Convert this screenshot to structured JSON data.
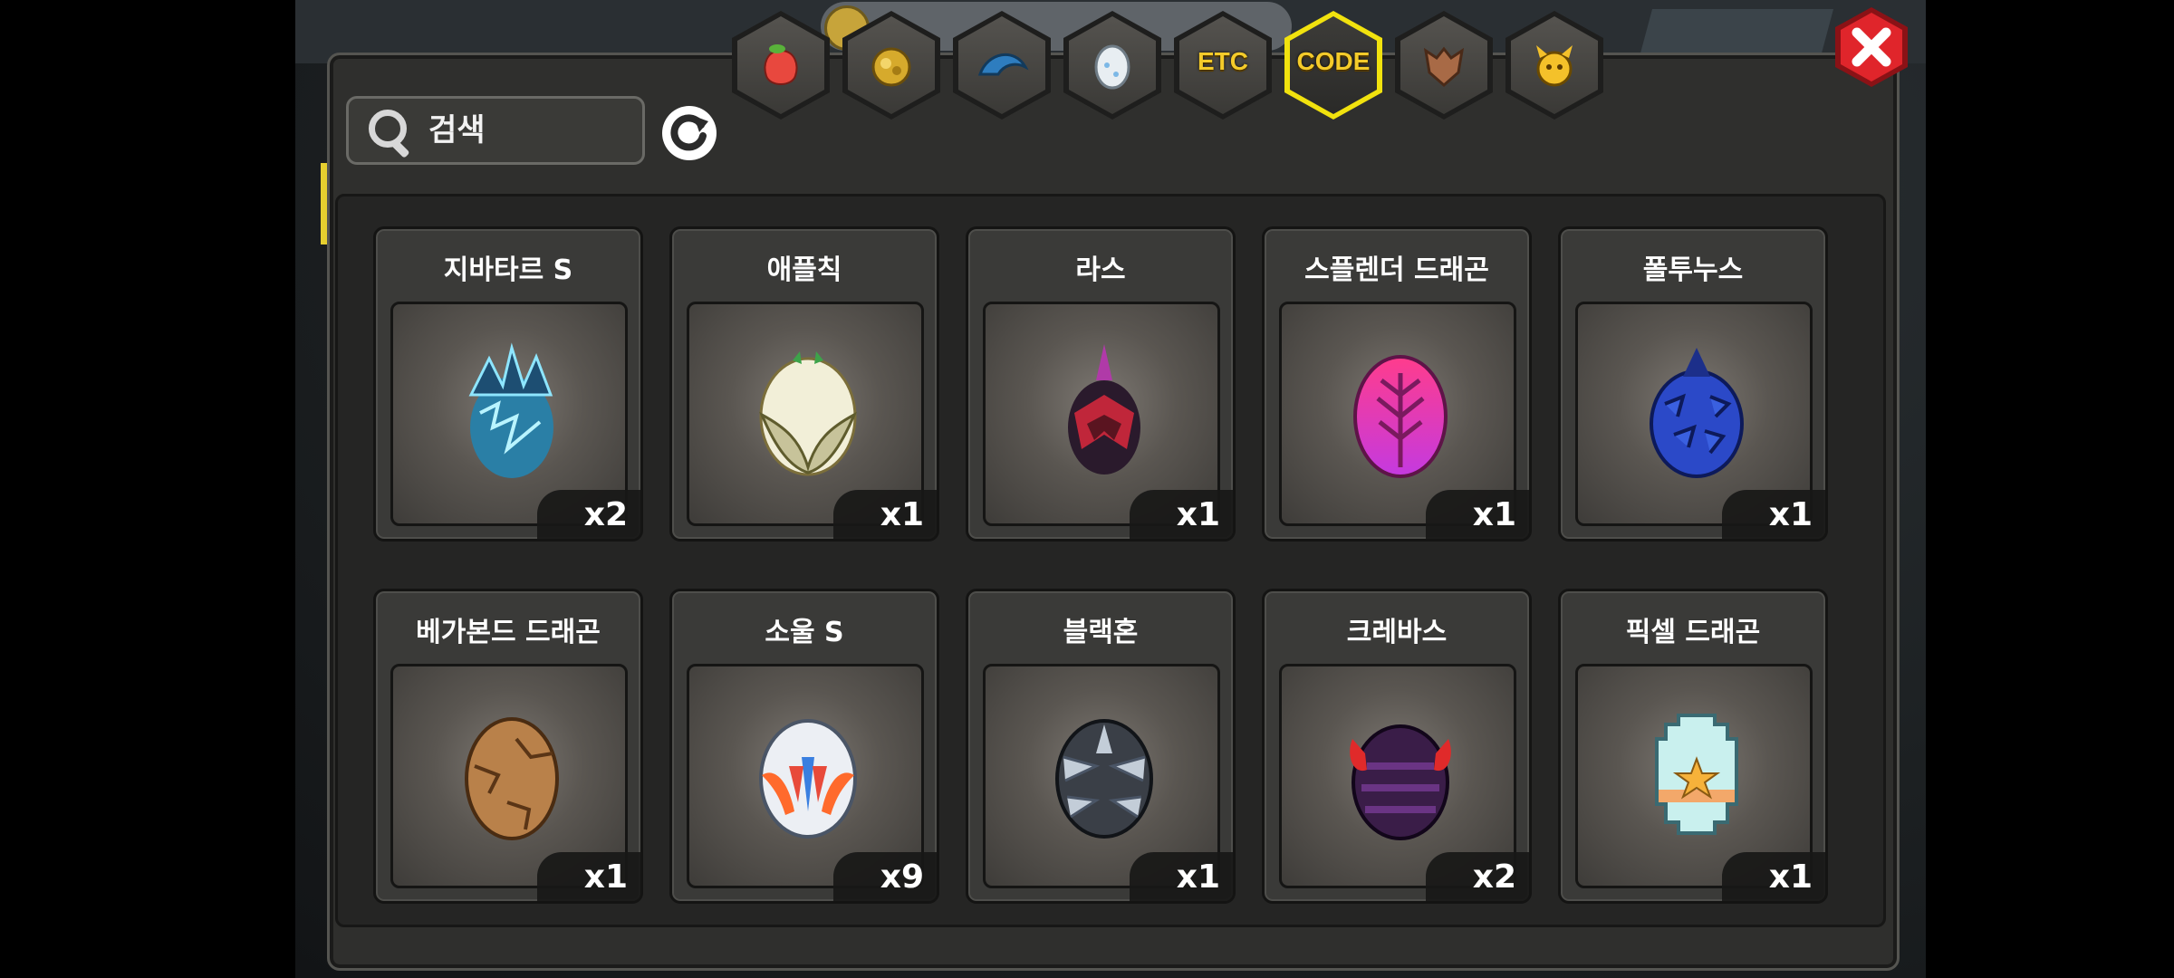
{
  "search": {
    "placeholder": "검색"
  },
  "tabs": [
    {
      "icon": "fruit-icon",
      "active": false
    },
    {
      "icon": "gold-ore-icon",
      "active": false
    },
    {
      "icon": "blue-wing-icon",
      "active": false
    },
    {
      "icon": "egg-icon",
      "active": false
    },
    {
      "label": "ETC",
      "active": false
    },
    {
      "label": "CODE",
      "active": true
    },
    {
      "icon": "beast-icon",
      "active": false
    },
    {
      "icon": "monster-face-icon",
      "active": false
    }
  ],
  "items": [
    {
      "name": "지바타르 S",
      "count": "x2",
      "egg": "storm-egg"
    },
    {
      "name": "애플칙",
      "count": "x1",
      "egg": "winged-cream-egg"
    },
    {
      "name": "라스",
      "count": "x1",
      "egg": "dark-red-spiked-egg"
    },
    {
      "name": "스플렌더 드래곤",
      "count": "x1",
      "egg": "pink-feather-egg"
    },
    {
      "name": "폴투누스",
      "count": "x1",
      "egg": "blue-scaled-egg"
    },
    {
      "name": "베가본드 드래곤",
      "count": "x1",
      "egg": "brown-cracked-egg"
    },
    {
      "name": "소울 S",
      "count": "x9",
      "egg": "white-flame-egg"
    },
    {
      "name": "블랙혼",
      "count": "x1",
      "egg": "silver-horn-egg"
    },
    {
      "name": "크레바스",
      "count": "x2",
      "egg": "purple-armored-egg"
    },
    {
      "name": "픽셀 드래곤",
      "count": "x1",
      "egg": "pixel-star-egg"
    }
  ],
  "colors": {
    "accent": "#f1e20e",
    "close": "#e0252b"
  }
}
